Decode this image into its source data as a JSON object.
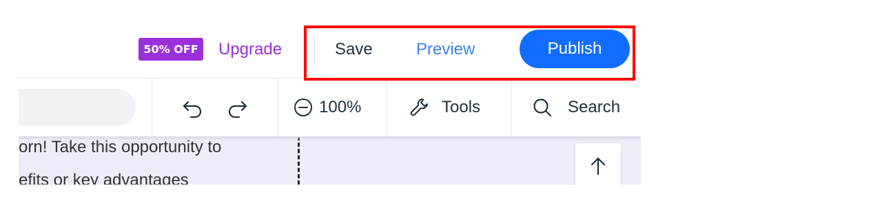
{
  "topbar": {
    "badge_label": "50% OFF",
    "upgrade_label": "Upgrade",
    "save_label": "Save",
    "preview_label": "Preview",
    "publish_label": "Publish"
  },
  "toolbar": {
    "undo_icon": "undo-icon",
    "redo_icon": "redo-icon",
    "zoom_label": "100%",
    "tools_label": "Tools",
    "search_label": "Search"
  },
  "canvas": {
    "line1": "orn! Take this opportunity to",
    "line2": "efits or key advantages"
  },
  "colors": {
    "publish": "#116dff",
    "preview": "#3b82f6",
    "upgrade": "#9b30d9",
    "highlight": "#ff0000"
  }
}
